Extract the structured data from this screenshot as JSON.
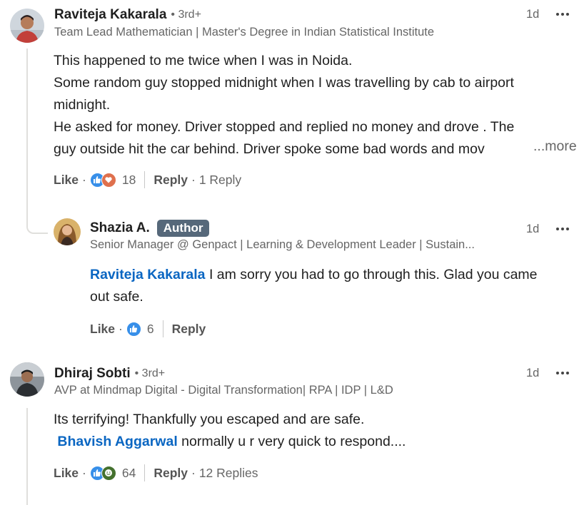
{
  "comments": [
    {
      "author": "Raviteja Kakarala",
      "degree": "• 3rd+",
      "headline": "Team Lead Mathematician | Master's Degree in Indian Statistical Institute",
      "time": "1d",
      "lines": [
        "This happened to me twice when I was in Noida.",
        "Some random guy stopped midnight when I was travelling by cab to airport",
        "midnight.",
        "He asked for money. Driver stopped and replied no money and drove . The",
        "guy outside hit the car behind. Driver spoke some bad words and mov"
      ],
      "see_more": "...more",
      "like": "Like",
      "reaction_icons": [
        "like-icon",
        "love-icon"
      ],
      "reaction_count": "18",
      "reply": "Reply",
      "reply_count": "1 Reply"
    },
    {
      "author": "Shazia A.",
      "badge": "Author",
      "headline": "Senior Manager @ Genpact | Learning & Development Leader | Sustain...",
      "time": "1d",
      "mention": "Raviteja Kakarala",
      "line1_rest": " I am sorry you had to go through this. Glad you came",
      "line2": "out safe.",
      "like": "Like",
      "reaction_icons": [
        "like-icon"
      ],
      "reaction_count": "6",
      "reply": "Reply"
    },
    {
      "author": "Dhiraj Sobti",
      "degree": "• 3rd+",
      "headline": "AVP at Mindmap Digital - Digital Transformation| RPA | IDP | L&D",
      "time": "1d",
      "line1": "Its terrifying! Thankfully you escaped and are safe.",
      "mention": "Bhavish Aggarwal",
      "line2_rest": " normally u r very quick to respond....",
      "like": "Like",
      "reaction_icons": [
        "like-icon",
        "funny-icon"
      ],
      "reaction_count": "64",
      "reply": "Reply",
      "reply_count": "12 Replies"
    }
  ],
  "colors": {
    "link": "#0a66c2",
    "like_reaction": "#378fe9",
    "love_reaction": "#df704d",
    "funny_reaction": "#44712e",
    "author_badge": "#56687a"
  }
}
